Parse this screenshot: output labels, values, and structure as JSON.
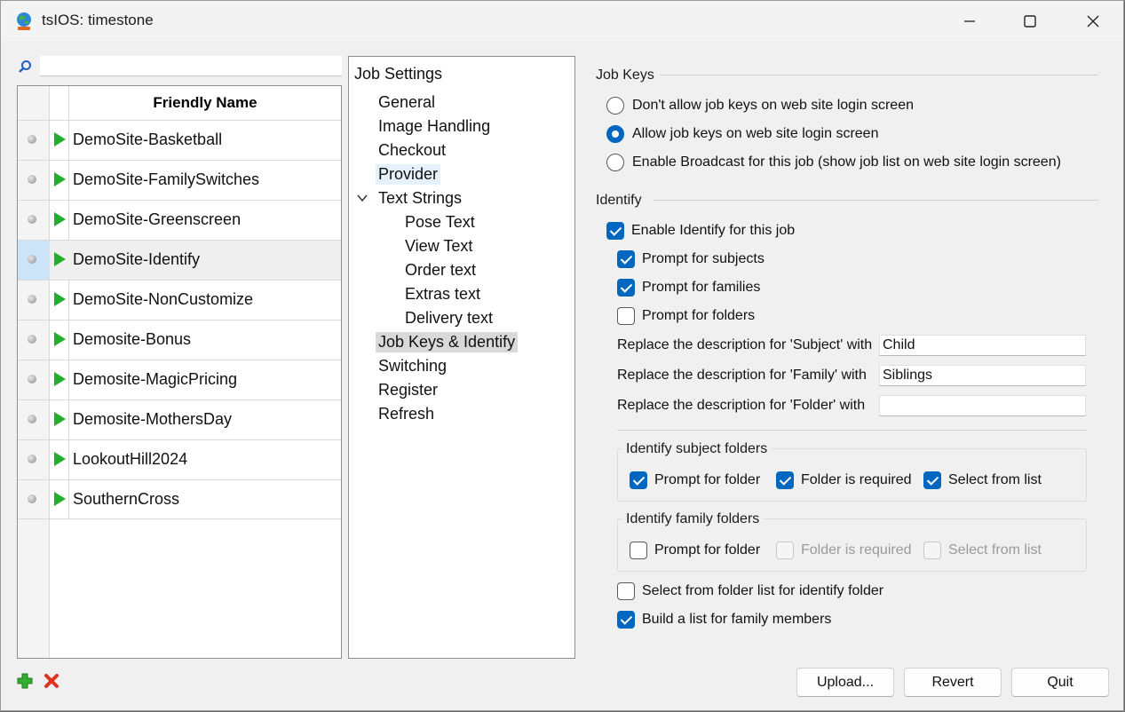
{
  "window": {
    "title": "tsIOS: timestone"
  },
  "search": {
    "value": "",
    "placeholder": ""
  },
  "job_list": {
    "header": "Friendly Name",
    "rows": [
      {
        "label": "DemoSite-Basketball",
        "selected": false
      },
      {
        "label": "DemoSite-FamilySwitches",
        "selected": false
      },
      {
        "label": "DemoSite-Greenscreen",
        "selected": false
      },
      {
        "label": "DemoSite-Identify",
        "selected": true
      },
      {
        "label": "DemoSite-NonCustomize",
        "selected": false
      },
      {
        "label": "Demosite-Bonus",
        "selected": false
      },
      {
        "label": "Demosite-MagicPricing",
        "selected": false
      },
      {
        "label": "Demosite-MothersDay",
        "selected": false
      },
      {
        "label": "LookoutHill2024",
        "selected": false
      },
      {
        "label": "SouthernCross",
        "selected": false
      }
    ]
  },
  "settings_tree": {
    "root": "Job Settings",
    "items": [
      {
        "label": "General"
      },
      {
        "label": "Image Handling"
      },
      {
        "label": "Checkout"
      },
      {
        "label": "Provider"
      },
      {
        "label": "Text Strings",
        "expanded": true
      },
      {
        "label": "Pose Text"
      },
      {
        "label": "View Text"
      },
      {
        "label": "Order text"
      },
      {
        "label": "Extras text"
      },
      {
        "label": "Delivery text"
      },
      {
        "label": "Job Keys & Identify",
        "selected": true
      },
      {
        "label": "Switching"
      },
      {
        "label": "Register"
      },
      {
        "label": "Refresh"
      }
    ]
  },
  "job_keys": {
    "title": "Job Keys",
    "options": [
      {
        "label": "Don't allow job keys on web site login screen",
        "checked": false
      },
      {
        "label": "Allow job keys on web site login screen",
        "checked": true
      },
      {
        "label": "Enable Broadcast for this job (show job list on web site login screen)",
        "checked": false
      }
    ]
  },
  "identify": {
    "title": "Identify",
    "enable_label": "Enable Identify for this job",
    "prompt_subjects": "Prompt for subjects",
    "prompt_families": "Prompt for families",
    "prompt_folders": "Prompt for folders",
    "replace_subject_label": "Replace the description for 'Subject' with",
    "replace_subject_value": "Child",
    "replace_family_label": "Replace the description for 'Family' with",
    "replace_family_value": "Siblings",
    "replace_folder_label": "Replace the description for 'Folder' with",
    "replace_folder_value": "",
    "subject_folders": {
      "title": "Identify subject folders",
      "prompt": "Prompt for folder",
      "required": "Folder is required",
      "select": "Select from list"
    },
    "family_folders": {
      "title": "Identify family folders",
      "prompt": "Prompt for folder",
      "required": "Folder is required",
      "select": "Select from list"
    },
    "select_folder_list": "Select from folder list for identify folder",
    "build_family_list": "Build a list for family members"
  },
  "buttons": {
    "upload": "Upload...",
    "revert": "Revert",
    "quit": "Quit"
  },
  "colors": {
    "accent": "#0067c0",
    "play": "#22b02a",
    "delete": "#e0301e"
  }
}
